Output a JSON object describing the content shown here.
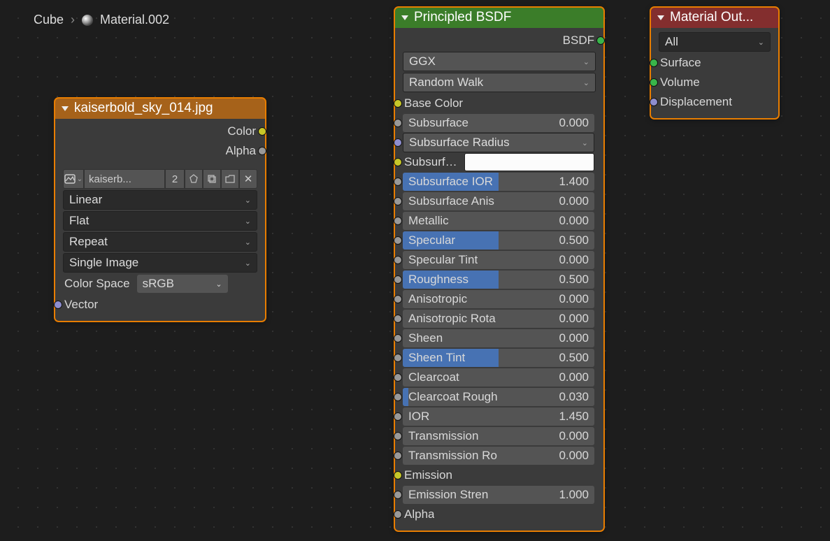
{
  "breadcrumb": {
    "obj": "Cube",
    "mat": "Material.002"
  },
  "imgNode": {
    "title": "kaiserbold_sky_014.jpg",
    "outputs": {
      "color": "Color",
      "alpha": "Alpha"
    },
    "imageName": "kaiserb...",
    "userCount": "2",
    "interp": "Linear",
    "proj": "Flat",
    "ext": "Repeat",
    "source": "Single Image",
    "csLabel": "Color Space",
    "csValue": "sRGB",
    "vector": "Vector"
  },
  "bsdf": {
    "title": "Principled BSDF",
    "outLabel": "BSDF",
    "dist": "GGX",
    "sss": "Random Walk",
    "baseColor": "Base Color",
    "subsurfRadius": "Subsurface Radius",
    "subsurfColorLabel": "Subsurfa...",
    "emission": "Emission",
    "alpha": "Alpha",
    "sliders": [
      {
        "name": "subsurface",
        "label": "Subsurface",
        "value": "0.000",
        "fill": 0
      },
      {
        "name": "subsurface-ior",
        "label": "Subsurface IOR",
        "value": "1.400",
        "fill": 0.5
      },
      {
        "name": "subsurface-anis",
        "label": "Subsurface Anis",
        "value": "0.000",
        "fill": 0
      },
      {
        "name": "metallic",
        "label": "Metallic",
        "value": "0.000",
        "fill": 0
      },
      {
        "name": "specular",
        "label": "Specular",
        "value": "0.500",
        "fill": 0.5
      },
      {
        "name": "specular-tint",
        "label": "Specular Tint",
        "value": "0.000",
        "fill": 0
      },
      {
        "name": "roughness",
        "label": "Roughness",
        "value": "0.500",
        "fill": 0.5
      },
      {
        "name": "anisotropic",
        "label": "Anisotropic",
        "value": "0.000",
        "fill": 0
      },
      {
        "name": "anisotropic-rot",
        "label": "Anisotropic Rota",
        "value": "0.000",
        "fill": 0
      },
      {
        "name": "sheen",
        "label": "Sheen",
        "value": "0.000",
        "fill": 0
      },
      {
        "name": "sheen-tint",
        "label": "Sheen Tint",
        "value": "0.500",
        "fill": 0.5
      },
      {
        "name": "clearcoat",
        "label": "Clearcoat",
        "value": "0.000",
        "fill": 0
      },
      {
        "name": "clearcoat-rough",
        "label": "Clearcoat Rough",
        "value": "0.030",
        "fill": 0.03
      },
      {
        "name": "ior",
        "label": "IOR",
        "value": "1.450",
        "fill": 0
      },
      {
        "name": "transmission",
        "label": "Transmission",
        "value": "0.000",
        "fill": 0
      },
      {
        "name": "transmission-rough",
        "label": "Transmission Ro",
        "value": "0.000",
        "fill": 0
      },
      {
        "name": "emission-strength",
        "label": "Emission Stren",
        "value": "1.000",
        "fill": 0
      }
    ]
  },
  "outNode": {
    "title": "Material Out...",
    "target": "All",
    "surface": "Surface",
    "volume": "Volume",
    "disp": "Displacement"
  }
}
